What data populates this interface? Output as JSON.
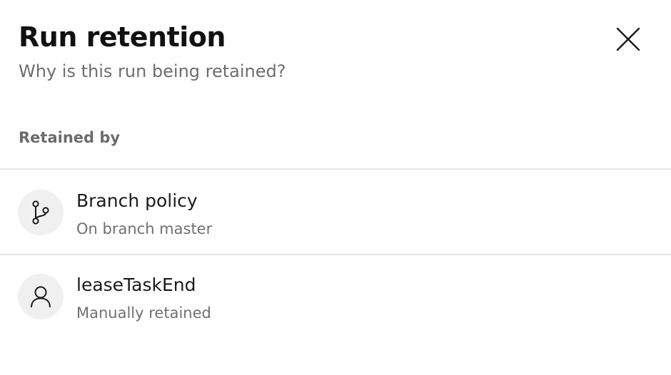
{
  "dialog": {
    "title": "Run retention",
    "subtitle": "Why is this run being retained?",
    "close_icon": "close-icon"
  },
  "section": {
    "header": "Retained by"
  },
  "items": [
    {
      "icon": "branch-icon",
      "title": "Branch policy",
      "description": "On branch master"
    },
    {
      "icon": "person-icon",
      "title": "leaseTaskEnd",
      "description": "Manually retained"
    }
  ],
  "colors": {
    "text_primary": "#1b1b1b",
    "text_secondary": "#707070",
    "avatar_bg": "#f0f0f0",
    "divider": "#e6e6e6"
  }
}
